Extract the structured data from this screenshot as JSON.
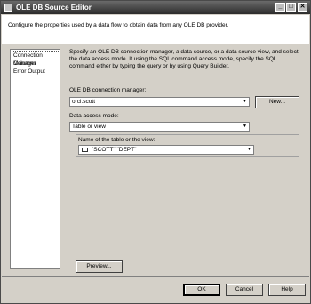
{
  "window": {
    "title": "OLE DB Source Editor"
  },
  "header": {
    "description": "Configure the properties used by a data flow to obtain data from any OLE DB provider."
  },
  "nav": {
    "items": [
      "Connection Manager",
      "Columns",
      "Error Output"
    ],
    "selected": "Connection Manager"
  },
  "main": {
    "description": "Specify an OLE DB connection manager, a data source, or a data source view, and select the data access mode. If using the SQL command access mode, specify the SQL command either by typing the query or by using Query Builder.",
    "connection_manager": {
      "label": "OLE DB connection manager:",
      "value": "orcl.scott",
      "new_button": "New..."
    },
    "access_mode": {
      "label": "Data access mode:",
      "value": "Table or view"
    },
    "table": {
      "label": "Name of the table or the view:",
      "value": "\"SCOTT\".\"DEPT\""
    },
    "preview_button": "Preview..."
  },
  "footer": {
    "ok": "OK",
    "cancel": "Cancel",
    "help": "Help"
  }
}
